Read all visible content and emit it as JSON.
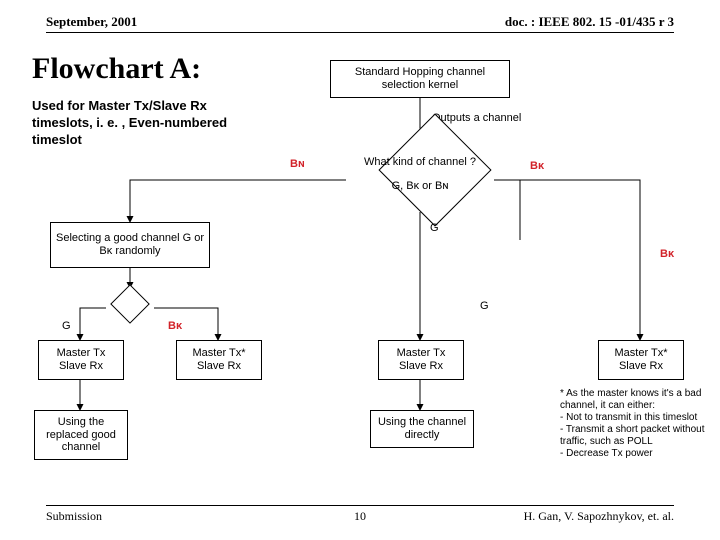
{
  "header": {
    "left": "September, 2001",
    "right": "doc. : IEEE 802. 15 -01/435 r 3"
  },
  "footer": {
    "left": "Submission",
    "center": "10",
    "right": "H. Gan, V. Sapozhnykov, et. al."
  },
  "title": "Flowchart A:",
  "subtitle": "Used for Master Tx/Slave Rx timeslots, i. e. , Even-numbered timeslot",
  "flow": {
    "kernel_box": "Standard Hopping channel selection kernel",
    "outputs": "Outputs a channel",
    "decision1": "What kind of channel ?",
    "decision1_sub": "G, Bᴋ or Bɴ",
    "bn_label": "Bɴ",
    "bk_label": "Bᴋ",
    "g_label": "G",
    "select_box": "Selecting a good channel G or Bᴋ randomly",
    "decision2_g": "G",
    "decision2_bk": "Bᴋ",
    "mt_sr_1": "Master Tx\nSlave Rx",
    "mt_star_sr_2": "Master Tx*\nSlave Rx",
    "mt_sr_3": "Master Tx\nSlave Rx",
    "mt_star_sr_4": "Master Tx*\nSlave Rx",
    "note_replaced": "Using the replaced good channel",
    "note_direct": "Using the channel directly",
    "asterisk_note": "* As the master knows it's a bad channel, it can either:\n- Not to transmit in this timeslot\n- Transmit a short packet without traffic, such as POLL\n- Decrease Tx power"
  },
  "colors": {
    "red": "#d2232a",
    "black": "#000000"
  }
}
